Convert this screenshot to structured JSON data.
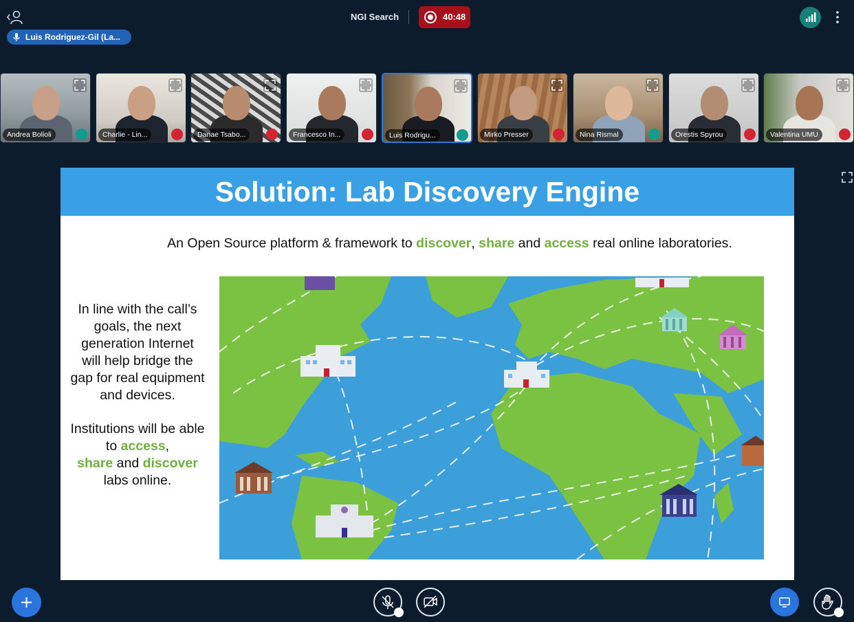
{
  "colors": {
    "background": "#0d1c2d",
    "accent_blue": "#2a75dd",
    "recording_red": "#a8111c",
    "slide_header_blue": "#3aa0e6",
    "slide_highlight_green": "#6fb03e",
    "muted_red": "#d32433",
    "live_green": "#129c8e"
  },
  "topbar": {
    "meeting_title": "NGI Search",
    "recording_time": "40:48",
    "users_icon": "user-icon",
    "connection_icon": "signal-bars-icon",
    "menu_icon": "kebab-menu-icon"
  },
  "talking_indicator": {
    "name": "Luis Rodriguez-Gil (La..."
  },
  "participants": [
    {
      "name": "Andrea Bolioli",
      "mic": "live",
      "active": false
    },
    {
      "name": "Charlie - Lin...",
      "mic": "muted",
      "active": false
    },
    {
      "name": "Danae Tsabo...",
      "mic": "muted",
      "active": false
    },
    {
      "name": "Francesco In...",
      "mic": "muted",
      "active": false
    },
    {
      "name": "Luis Rodrigu...",
      "mic": "live",
      "active": true
    },
    {
      "name": "Mirko Presser",
      "mic": "muted",
      "active": false
    },
    {
      "name": "Nina Rismal",
      "mic": "live",
      "active": false
    },
    {
      "name": "Orestis Spyrou",
      "mic": "muted",
      "active": false
    },
    {
      "name": "Valentina UMU",
      "mic": "muted",
      "active": false
    }
  ],
  "slide": {
    "title": "Solution: Lab Discovery Engine",
    "subtitle": {
      "part1": "An Open Source platform & framework to ",
      "discover": "discover",
      "sep1": ", ",
      "share": "share",
      "and1": " and ",
      "access": "access",
      "part2": " real online laboratories."
    },
    "left_text": {
      "para1": "In line with the call’s goals, the next generation Internet will help bridge the gap for real equipment and devices.",
      "p2_start": "Institutions will be able to ",
      "p2_access": "access",
      "p2_comma": ",",
      "p2_share": "share",
      "p2_and": " and ",
      "p2_discover": "discover",
      "p2_end": " labs online."
    }
  },
  "bottombar": {
    "actions_icon": "plus-icon",
    "mic_icon": "microphone-muted-icon",
    "camera_icon": "camera-off-icon",
    "screenshare_icon": "monitor-icon",
    "raise_hand_icon": "hand-icon"
  }
}
